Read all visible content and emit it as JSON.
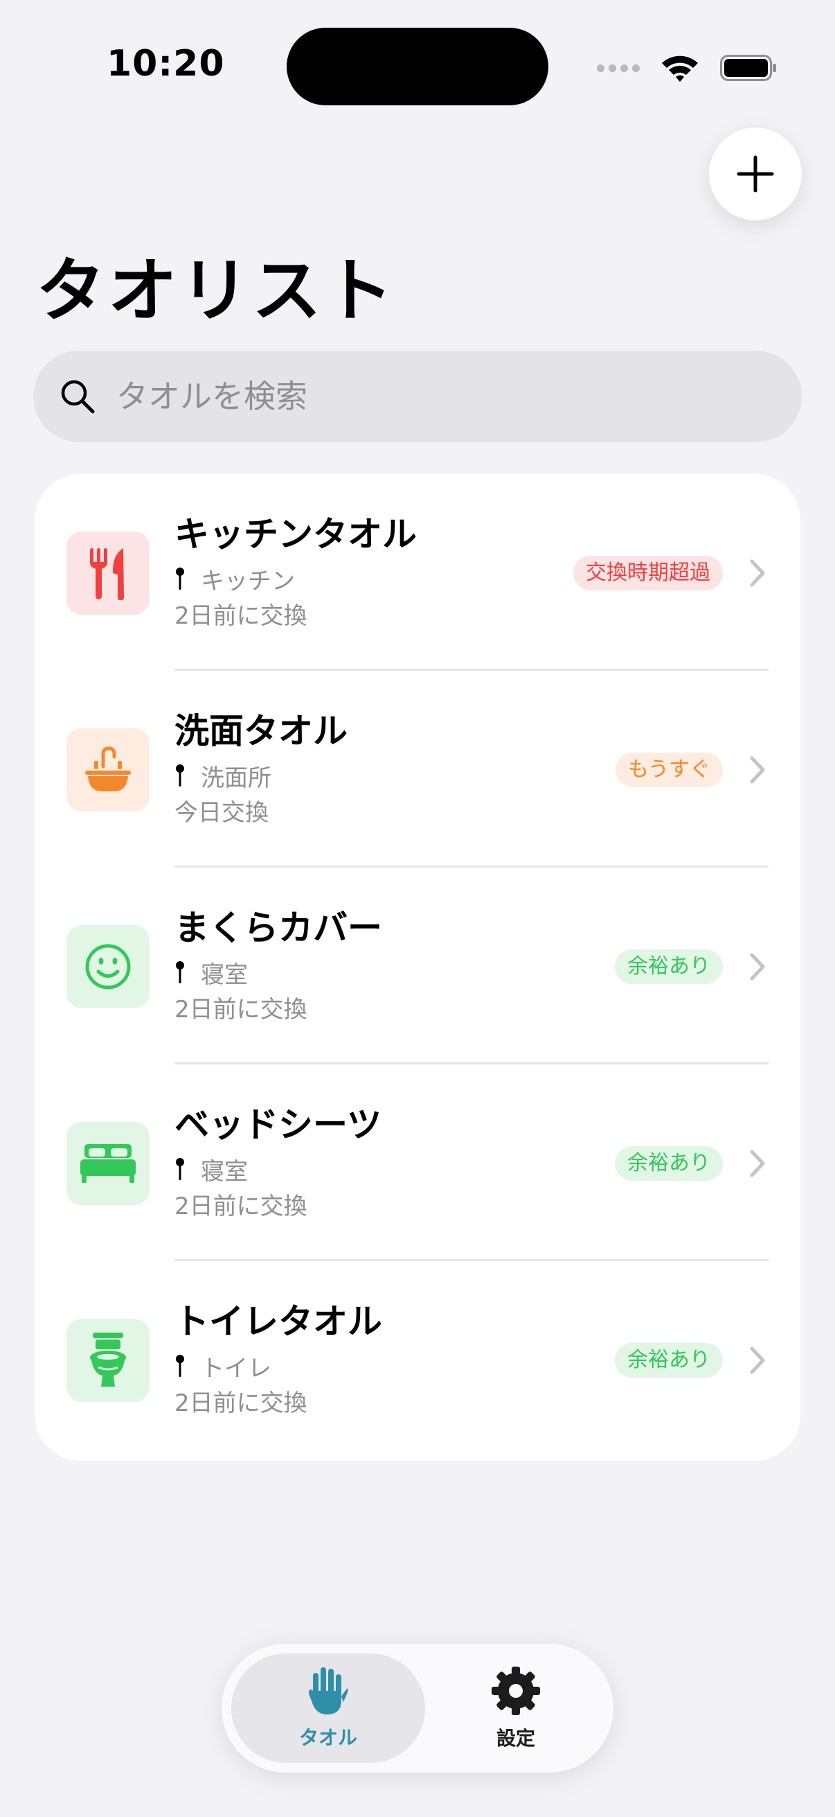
{
  "status": {
    "time": "10:20"
  },
  "header": {
    "title": "タオリスト"
  },
  "search": {
    "placeholder": "タオルを検索"
  },
  "colors": {
    "overdue": "#f04040",
    "soon": "#f5882a",
    "ok": "#34c759",
    "tab_active": "#2f8ea8",
    "chevron": "#c4c4c7"
  },
  "items": [
    {
      "name": "キッチンタオル",
      "location": "キッチン",
      "last_changed": "2日前に交換",
      "status": "交換時期超過",
      "icon": "fork-knife-icon"
    },
    {
      "name": "洗面タオル",
      "location": "洗面所",
      "last_changed": "今日交換",
      "status": "もうすぐ",
      "icon": "sink-icon"
    },
    {
      "name": "まくらカバー",
      "location": "寝室",
      "last_changed": "2日前に交換",
      "status": "余裕あり",
      "icon": "smiley-face-icon"
    },
    {
      "name": "ベッドシーツ",
      "location": "寝室",
      "last_changed": "2日前に交換",
      "status": "余裕あり",
      "icon": "bed-icon"
    },
    {
      "name": "トイレタオル",
      "location": "トイレ",
      "last_changed": "2日前に交換",
      "status": "余裕あり",
      "icon": "toilet-icon"
    }
  ],
  "tabs": [
    {
      "label": "タオル",
      "icon": "hand-icon",
      "active": true
    },
    {
      "label": "設定",
      "icon": "gear-icon",
      "active": false
    }
  ]
}
